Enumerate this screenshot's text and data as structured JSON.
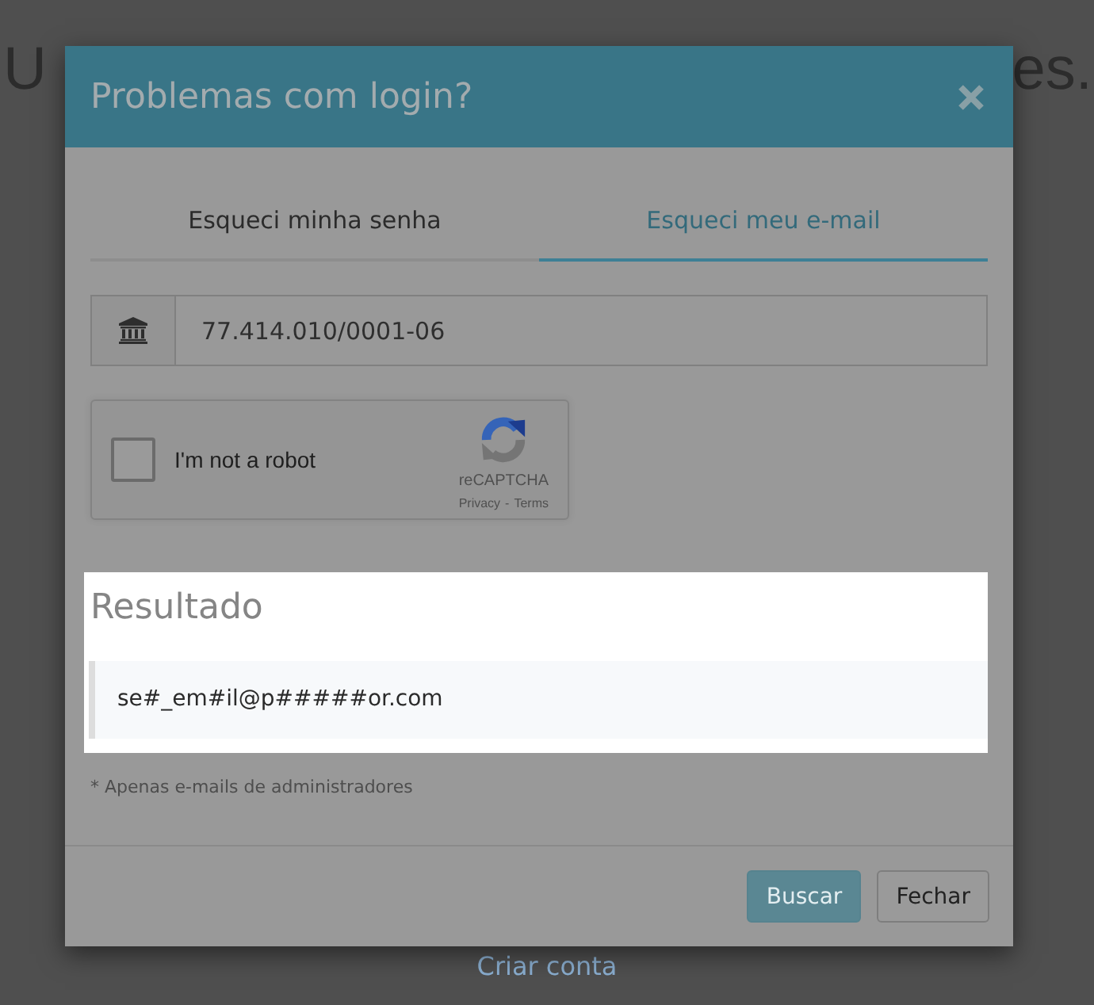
{
  "page": {
    "heading_left": "U",
    "heading_right": "es.",
    "link": "Criar conta"
  },
  "dialog": {
    "title": "Problemas com login?"
  },
  "tabs": [
    {
      "label": "Esqueci minha senha",
      "selected": false
    },
    {
      "label": "Esqueci meu e-mail",
      "selected": true
    }
  ],
  "document_field": {
    "value": "77.414.010/0001-06"
  },
  "captcha": {
    "label": "I'm not a robot",
    "checked": false,
    "brand": "reCAPTCHA",
    "privacy": "Privacy",
    "separator": "-",
    "terms": "Terms"
  },
  "result": {
    "title": "Resultado",
    "value": "se#_em#il@p#####or.com",
    "highlighted": true
  },
  "note": "* Apenas e-mails de administradores",
  "buttons": [
    {
      "label": "Buscar",
      "kind": "primary",
      "disabled": true
    },
    {
      "label": "Fechar",
      "kind": "default",
      "disabled": false
    }
  ]
}
